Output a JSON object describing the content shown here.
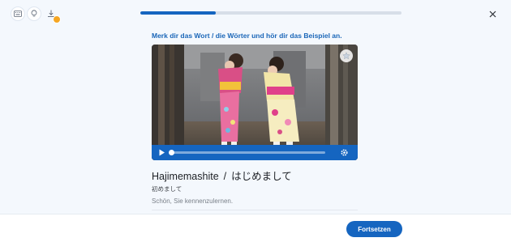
{
  "toolbar": {
    "icons": [
      "keyboard-icon",
      "lightbulb-icon",
      "download-icon"
    ],
    "accent_color": "#1565c0",
    "badge_color": "#f5a623"
  },
  "progress": {
    "fraction": 0.29
  },
  "instruction": "Merk dir das Wort / die Wörter und hör dir das Beispiel an.",
  "media": {
    "favorite_icon": "star-icon",
    "player": {
      "playback_fraction": 0.0,
      "play_icon": "play-icon",
      "settings_icon": "gear-icon"
    }
  },
  "word": {
    "romaji": "Hajimemashite",
    "separator": "/",
    "kana": "はじめまして",
    "kanji": "初めまして",
    "translation": "Schön, Sie kennenzulernen."
  },
  "footer": {
    "continue_label": "Fortsetzen"
  }
}
